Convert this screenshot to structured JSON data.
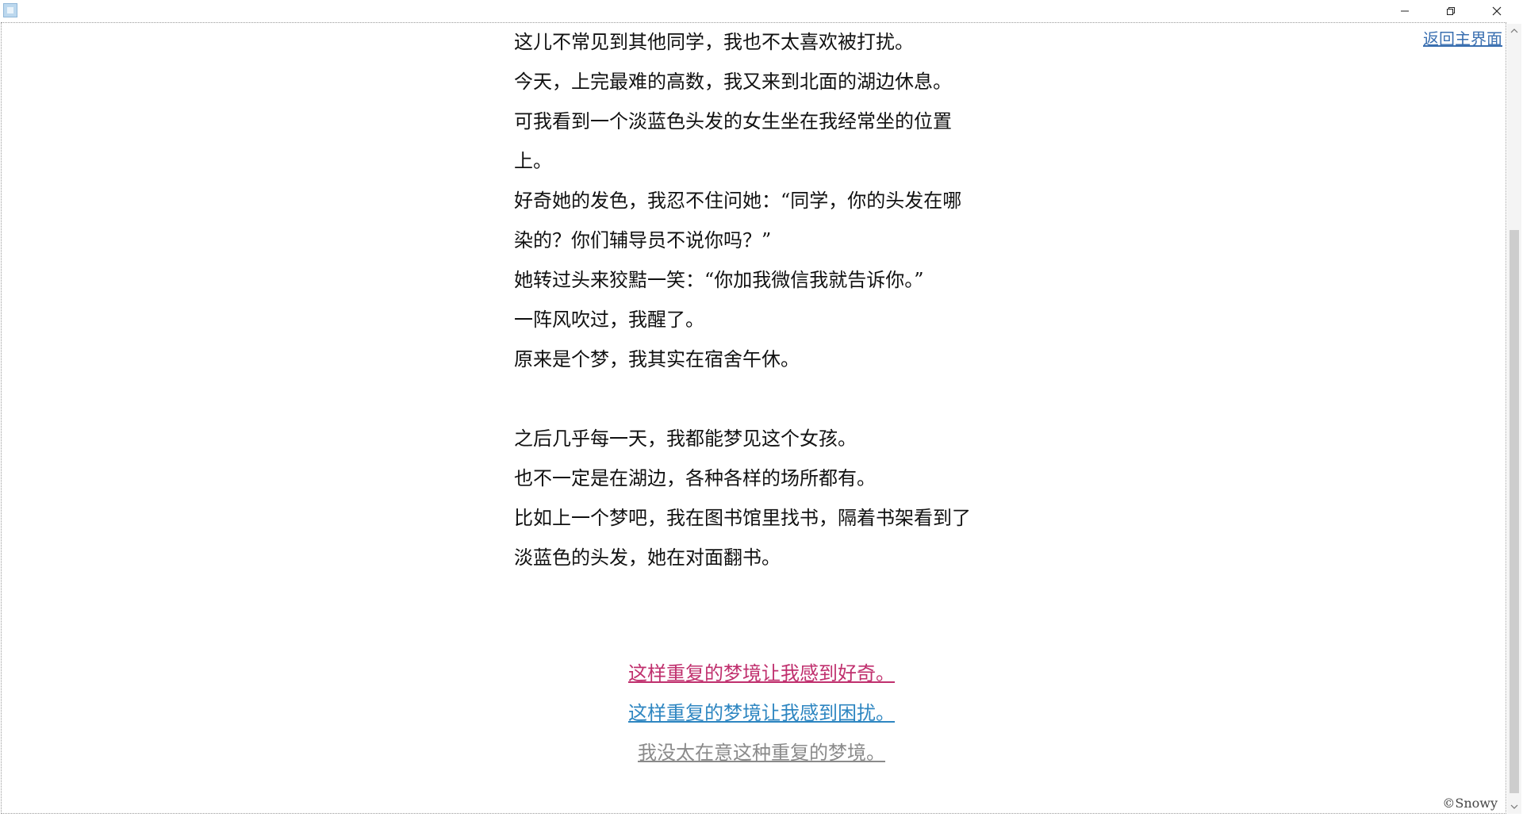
{
  "window": {
    "icons": {
      "app": "app-icon",
      "minimize": "minimize-icon",
      "maximize": "restore-icon",
      "close": "close-icon"
    }
  },
  "header": {
    "back_label": "返回主界面"
  },
  "story": {
    "lines": [
      "这儿不常见到其他同学，我也不太喜欢被打扰。",
      "今天，上完最难的高数，我又来到北面的湖边休息。",
      "可我看到一个淡蓝色头发的女生坐在我经常坐的位置",
      "上。",
      "好奇她的发色，我忍不住问她：“同学，你的头发在哪",
      "染的？你们辅导员不说你吗？”",
      "她转过头来狡黠一笑：“你加我微信我就告诉你。”",
      "一阵风吹过，我醒了。",
      "原来是个梦，我其实在宿舍午休。",
      "",
      "之后几乎每一天，我都能梦见这个女孩。",
      "也不一定是在湖边，各种各样的场所都有。",
      "比如上一个梦吧，我在图书馆里找书，隔着书架看到了",
      "淡蓝色的头发，她在对面翻书。"
    ]
  },
  "choices": [
    {
      "label": "这样重复的梦境让我感到好奇。",
      "color": "#c0306e"
    },
    {
      "label": "这样重复的梦境让我感到困扰。",
      "color": "#2e86c1"
    },
    {
      "label": "我没太在意这种重复的梦境。",
      "color": "#8a8a8a"
    }
  ],
  "footer": {
    "copyright": "©Snowy"
  }
}
